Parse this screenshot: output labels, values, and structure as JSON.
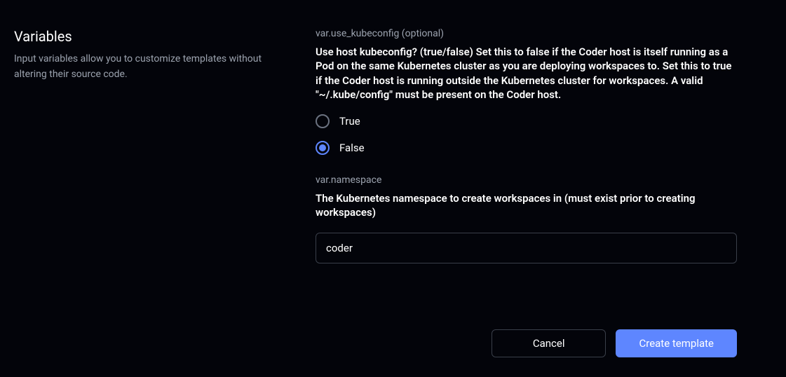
{
  "sidebar": {
    "title": "Variables",
    "description": "Input variables allow you to customize templates without altering their source code."
  },
  "variables": {
    "use_kubeconfig": {
      "name": "var.use_kubeconfig (optional)",
      "description": "Use host kubeconfig? (true/false) Set this to false if the Coder host is itself running as a Pod on the same Kubernetes cluster as you are deploying workspaces to. Set this to true if the Coder host is running outside the Kubernetes cluster for workspaces. A valid \"~/.kube/config\" must be present on the Coder host.",
      "options": {
        "true_label": "True",
        "false_label": "False"
      },
      "selected": "false"
    },
    "namespace": {
      "name": "var.namespace",
      "description": "The Kubernetes namespace to create workspaces in (must exist prior to creating workspaces)",
      "value": "coder"
    }
  },
  "buttons": {
    "cancel": "Cancel",
    "create": "Create template"
  }
}
